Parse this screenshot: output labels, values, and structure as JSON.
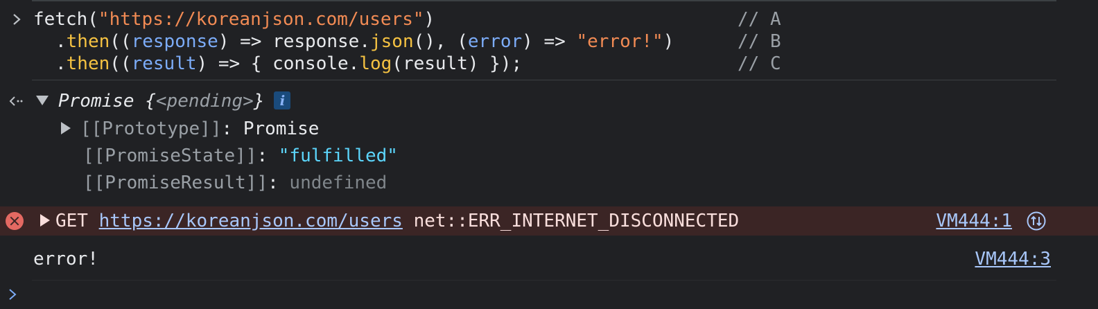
{
  "console": {
    "input": {
      "line1": {
        "fn": "fetch(",
        "url": "\"https://koreanjson.com/users\"",
        "close": ")",
        "comment": "// A"
      },
      "line2": {
        "dot": ".",
        "then": "then",
        "open": "((",
        "param1": "response",
        "mid1": ") => response.",
        "json": "json",
        "mid2": "(), (",
        "param2": "error",
        "mid3": ") => ",
        "str": "\"error!\"",
        "close": ")",
        "comment": "// B"
      },
      "line3": {
        "dot": ".",
        "then": "then",
        "open": "((",
        "param1": "result",
        "mid1": ") => { console.",
        "log": "log",
        "mid2": "(result) });",
        "comment": "// C"
      }
    },
    "result": {
      "promise_label": "Promise ",
      "open_brace": "{",
      "pending": "<pending>",
      "close_brace": "}",
      "info_badge": "i",
      "props": [
        {
          "key": "[[Prototype]]",
          "value": "Promise",
          "expandable": true
        },
        {
          "key": "[[PromiseState]]",
          "value": "\"fulfilled\"",
          "expandable": false
        },
        {
          "key": "[[PromiseResult]]",
          "value": "undefined",
          "expandable": false
        }
      ]
    },
    "error": {
      "method": "GET ",
      "url": "https://koreanjson.com/users",
      "message": " net::ERR_INTERNET_DISCONNECTED",
      "source": "VM444:1"
    },
    "log": {
      "text": "error!",
      "source": "VM444:3"
    }
  },
  "colors": {
    "background": "#202124",
    "string": "#f28b54",
    "param": "#7cacf8",
    "function": "#f5c242",
    "comment": "#9aa0a6",
    "link": "#a8c7fa",
    "error_bg": "#3b2525",
    "error_icon": "#e46962"
  },
  "icons": [
    "prompt-chevron-icon",
    "result-arrow-icon",
    "info-icon",
    "error-icon",
    "network-request-icon",
    "input-prompt-icon"
  ]
}
